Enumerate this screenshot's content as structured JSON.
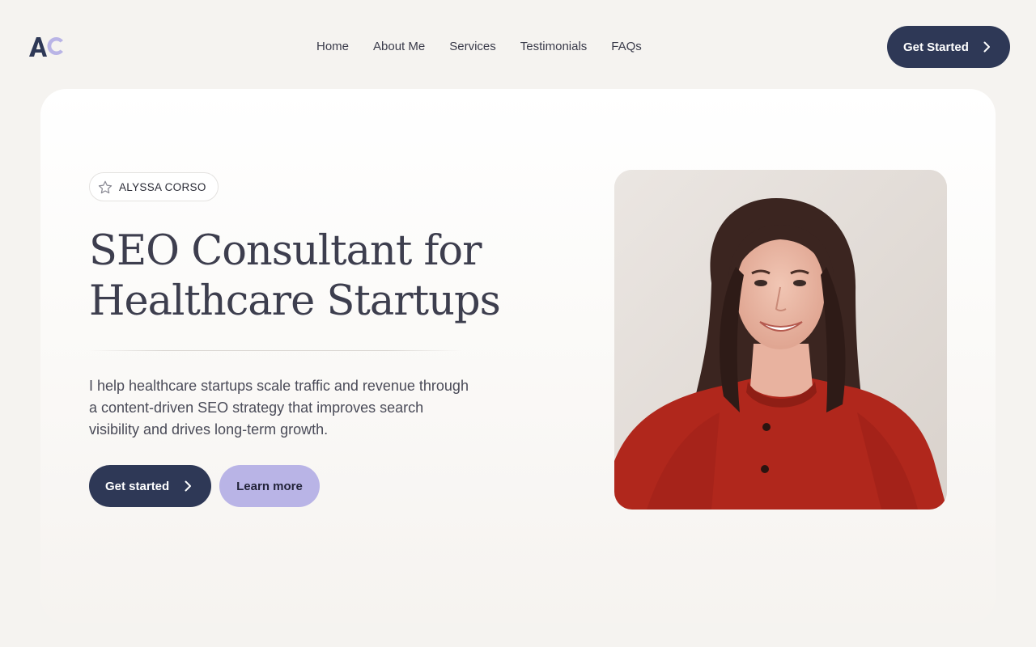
{
  "brand": {
    "logo_text": "AC"
  },
  "nav": {
    "items": [
      {
        "label": "Home"
      },
      {
        "label": "About Me"
      },
      {
        "label": "Services"
      },
      {
        "label": "Testimonials"
      },
      {
        "label": "FAQs"
      }
    ]
  },
  "header": {
    "cta_label": "Get Started"
  },
  "hero": {
    "badge_label": "ALYSSA CORSO",
    "headline_line1": "SEO Consultant for",
    "headline_line2": "Healthcare Startups",
    "description": "I help healthcare startups scale traffic and revenue through a content-driven SEO strategy that improves search visibility and drives long-term growth.",
    "primary_button": "Get started",
    "secondary_button": "Learn more"
  },
  "icons": {
    "badge_icon": "star-icon",
    "button_icon": "chevron-right-icon"
  },
  "colors": {
    "primary": "#2e3856",
    "accent": "#b9b4e6",
    "background": "#f5f3f0",
    "logo_a": "#2e3856",
    "logo_c": "#b9b4e6"
  }
}
